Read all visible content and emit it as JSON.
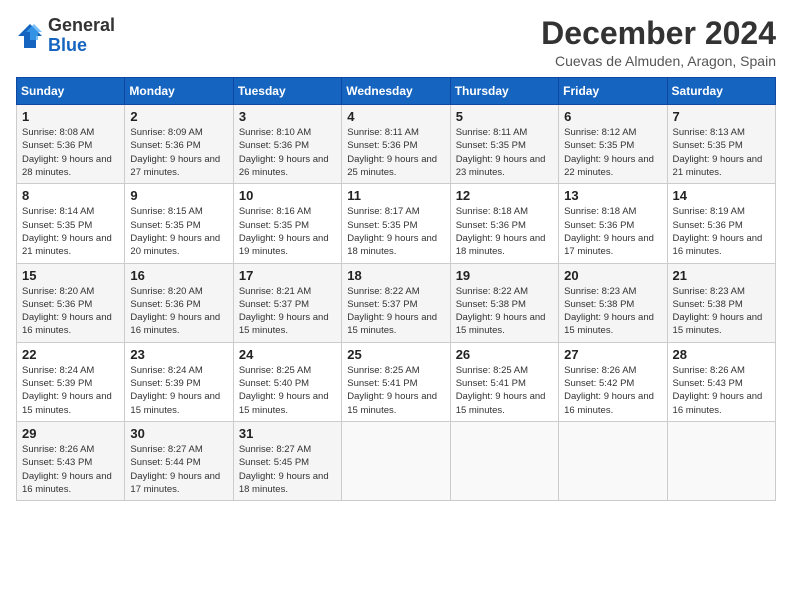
{
  "header": {
    "logo_general": "General",
    "logo_blue": "Blue",
    "month_title": "December 2024",
    "location": "Cuevas de Almuden, Aragon, Spain"
  },
  "calendar": {
    "days_of_week": [
      "Sunday",
      "Monday",
      "Tuesday",
      "Wednesday",
      "Thursday",
      "Friday",
      "Saturday"
    ],
    "weeks": [
      [
        {
          "day": "1",
          "sunrise": "8:08 AM",
          "sunset": "5:36 PM",
          "daylight": "9 hours and 28 minutes."
        },
        {
          "day": "2",
          "sunrise": "8:09 AM",
          "sunset": "5:36 PM",
          "daylight": "9 hours and 27 minutes."
        },
        {
          "day": "3",
          "sunrise": "8:10 AM",
          "sunset": "5:36 PM",
          "daylight": "9 hours and 26 minutes."
        },
        {
          "day": "4",
          "sunrise": "8:11 AM",
          "sunset": "5:36 PM",
          "daylight": "9 hours and 25 minutes."
        },
        {
          "day": "5",
          "sunrise": "8:11 AM",
          "sunset": "5:35 PM",
          "daylight": "9 hours and 23 minutes."
        },
        {
          "day": "6",
          "sunrise": "8:12 AM",
          "sunset": "5:35 PM",
          "daylight": "9 hours and 22 minutes."
        },
        {
          "day": "7",
          "sunrise": "8:13 AM",
          "sunset": "5:35 PM",
          "daylight": "9 hours and 21 minutes."
        }
      ],
      [
        {
          "day": "8",
          "sunrise": "8:14 AM",
          "sunset": "5:35 PM",
          "daylight": "9 hours and 21 minutes."
        },
        {
          "day": "9",
          "sunrise": "8:15 AM",
          "sunset": "5:35 PM",
          "daylight": "9 hours and 20 minutes."
        },
        {
          "day": "10",
          "sunrise": "8:16 AM",
          "sunset": "5:35 PM",
          "daylight": "9 hours and 19 minutes."
        },
        {
          "day": "11",
          "sunrise": "8:17 AM",
          "sunset": "5:35 PM",
          "daylight": "9 hours and 18 minutes."
        },
        {
          "day": "12",
          "sunrise": "8:18 AM",
          "sunset": "5:36 PM",
          "daylight": "9 hours and 18 minutes."
        },
        {
          "day": "13",
          "sunrise": "8:18 AM",
          "sunset": "5:36 PM",
          "daylight": "9 hours and 17 minutes."
        },
        {
          "day": "14",
          "sunrise": "8:19 AM",
          "sunset": "5:36 PM",
          "daylight": "9 hours and 16 minutes."
        }
      ],
      [
        {
          "day": "15",
          "sunrise": "8:20 AM",
          "sunset": "5:36 PM",
          "daylight": "9 hours and 16 minutes."
        },
        {
          "day": "16",
          "sunrise": "8:20 AM",
          "sunset": "5:36 PM",
          "daylight": "9 hours and 16 minutes."
        },
        {
          "day": "17",
          "sunrise": "8:21 AM",
          "sunset": "5:37 PM",
          "daylight": "9 hours and 15 minutes."
        },
        {
          "day": "18",
          "sunrise": "8:22 AM",
          "sunset": "5:37 PM",
          "daylight": "9 hours and 15 minutes."
        },
        {
          "day": "19",
          "sunrise": "8:22 AM",
          "sunset": "5:38 PM",
          "daylight": "9 hours and 15 minutes."
        },
        {
          "day": "20",
          "sunrise": "8:23 AM",
          "sunset": "5:38 PM",
          "daylight": "9 hours and 15 minutes."
        },
        {
          "day": "21",
          "sunrise": "8:23 AM",
          "sunset": "5:38 PM",
          "daylight": "9 hours and 15 minutes."
        }
      ],
      [
        {
          "day": "22",
          "sunrise": "8:24 AM",
          "sunset": "5:39 PM",
          "daylight": "9 hours and 15 minutes."
        },
        {
          "day": "23",
          "sunrise": "8:24 AM",
          "sunset": "5:39 PM",
          "daylight": "9 hours and 15 minutes."
        },
        {
          "day": "24",
          "sunrise": "8:25 AM",
          "sunset": "5:40 PM",
          "daylight": "9 hours and 15 minutes."
        },
        {
          "day": "25",
          "sunrise": "8:25 AM",
          "sunset": "5:41 PM",
          "daylight": "9 hours and 15 minutes."
        },
        {
          "day": "26",
          "sunrise": "8:25 AM",
          "sunset": "5:41 PM",
          "daylight": "9 hours and 15 minutes."
        },
        {
          "day": "27",
          "sunrise": "8:26 AM",
          "sunset": "5:42 PM",
          "daylight": "9 hours and 16 minutes."
        },
        {
          "day": "28",
          "sunrise": "8:26 AM",
          "sunset": "5:43 PM",
          "daylight": "9 hours and 16 minutes."
        }
      ],
      [
        {
          "day": "29",
          "sunrise": "8:26 AM",
          "sunset": "5:43 PM",
          "daylight": "9 hours and 16 minutes."
        },
        {
          "day": "30",
          "sunrise": "8:27 AM",
          "sunset": "5:44 PM",
          "daylight": "9 hours and 17 minutes."
        },
        {
          "day": "31",
          "sunrise": "8:27 AM",
          "sunset": "5:45 PM",
          "daylight": "9 hours and 18 minutes."
        },
        null,
        null,
        null,
        null
      ]
    ],
    "labels": {
      "sunrise": "Sunrise:",
      "sunset": "Sunset:",
      "daylight": "Daylight:"
    }
  }
}
